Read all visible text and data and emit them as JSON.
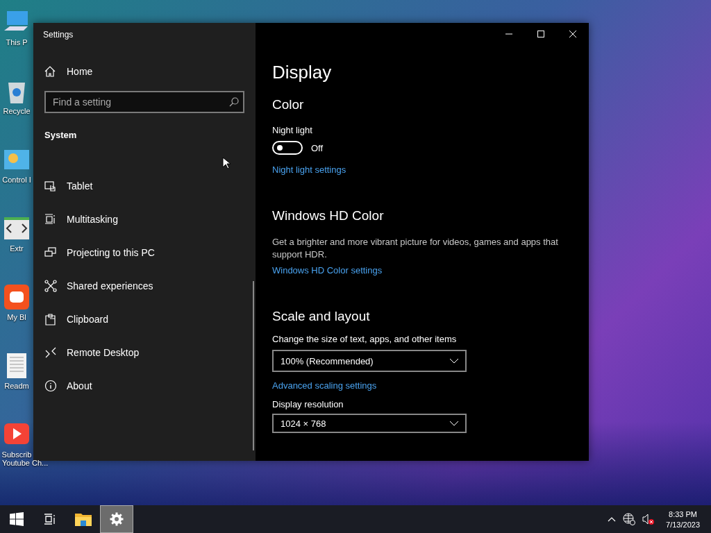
{
  "desktop_icons": [
    {
      "label": "This P"
    },
    {
      "label": "Recycle"
    },
    {
      "label": "Control I"
    },
    {
      "label": "Extr"
    },
    {
      "label": "My Bl"
    },
    {
      "label": "Readm"
    },
    {
      "label": "Subscrib",
      "label_2": "Youtube Ch..."
    }
  ],
  "window": {
    "title": "Settings"
  },
  "sidebar": {
    "home": "Home",
    "search": {
      "placeholder": "Find a setting"
    },
    "section": "System",
    "items": [
      {
        "kind": "tablet",
        "label": "Tablet"
      },
      {
        "kind": "multitasking",
        "label": "Multitasking"
      },
      {
        "kind": "projecting",
        "label": "Projecting to this PC"
      },
      {
        "kind": "shared",
        "label": "Shared experiences"
      },
      {
        "kind": "clipboard",
        "label": "Clipboard"
      },
      {
        "kind": "remote",
        "label": "Remote Desktop"
      },
      {
        "kind": "about",
        "label": "About"
      }
    ]
  },
  "content": {
    "title": "Display",
    "color": {
      "heading": "Color",
      "night_light": {
        "label": "Night light",
        "on": false,
        "state_text": "Off"
      },
      "link": "Night light settings"
    },
    "hd_color": {
      "heading": "Windows HD Color",
      "description": "Get a brighter and more vibrant picture for videos, games and apps that support HDR.",
      "link": "Windows HD Color settings"
    },
    "scale": {
      "heading": "Scale and layout",
      "size_label": "Change the size of text, apps, and other items",
      "size_value": "100% (Recommended)",
      "link": "Advanced scaling settings",
      "resolution_label": "Display resolution",
      "resolution_value": "1024 × 768"
    }
  },
  "taskbar": {
    "apps": [
      {
        "kind": "start",
        "selected": false
      },
      {
        "kind": "taskview",
        "selected": false
      },
      {
        "kind": "explorer",
        "selected": false
      },
      {
        "kind": "settings",
        "selected": true
      }
    ],
    "time": "8:33 PM",
    "date": "7/13/2023"
  }
}
